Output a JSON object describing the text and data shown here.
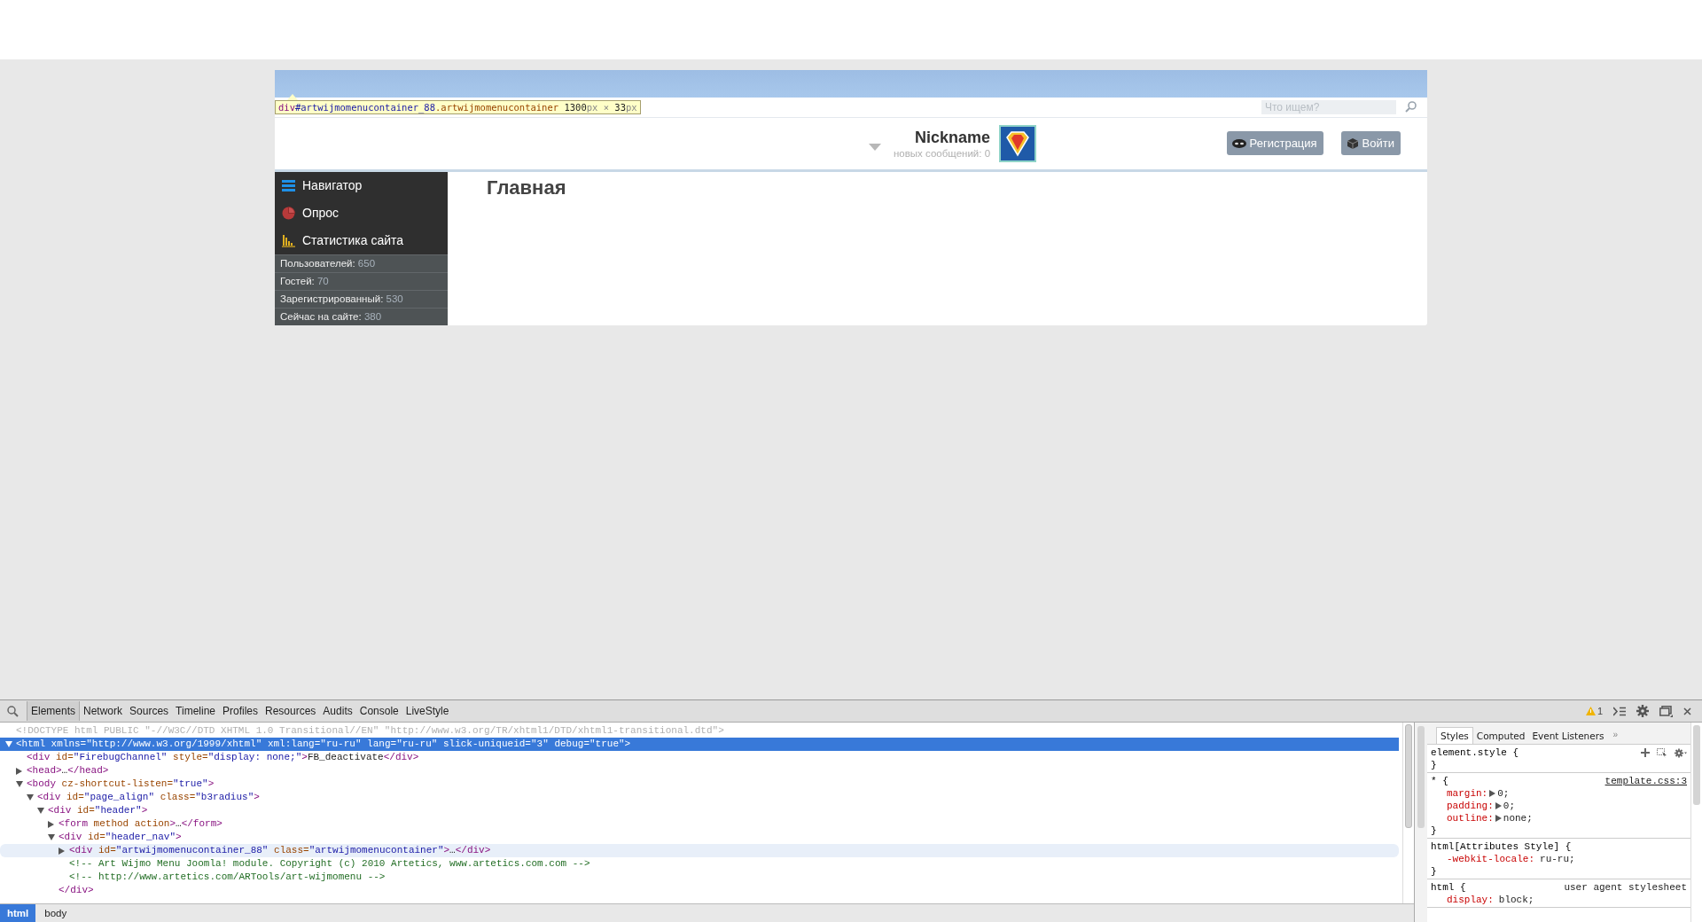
{
  "site": {
    "inspect_tooltip": [
      {
        "kind": "tag",
        "text": "div"
      },
      {
        "kind": "id",
        "text": "#artwijmomenucontainer_88"
      },
      {
        "kind": "class",
        "text": ".artwijmomenucontainer"
      },
      {
        "kind": "num",
        "text": " 1300"
      },
      {
        "kind": "unit",
        "text": "px"
      },
      {
        "kind": "unit",
        "text": " × "
      },
      {
        "kind": "num",
        "text": "33"
      },
      {
        "kind": "unit",
        "text": "px"
      }
    ],
    "search": {
      "placeholder": "Что ищем?"
    },
    "user": {
      "name": "Nickname",
      "messages": "новых сообщений: 0"
    },
    "buttons": [
      {
        "label": "Регистрация"
      },
      {
        "label": "Войти"
      }
    ],
    "sidebar": {
      "menu": [
        {
          "label": "Навигатор"
        },
        {
          "label": "Опрос"
        },
        {
          "label": "Статистика сайта"
        }
      ],
      "stats": [
        {
          "label": "Пользователей:",
          "value": "650"
        },
        {
          "label": "Гостей:",
          "value": "70"
        },
        {
          "label": "Зарегистрированный:",
          "value": "530"
        },
        {
          "label": "Сейчас на сайте:",
          "value": "380"
        }
      ]
    },
    "heading": "Главная"
  },
  "devtools": {
    "tabs": [
      {
        "label": "Elements",
        "selected": true
      },
      {
        "label": "Network",
        "selected": false
      },
      {
        "label": "Sources",
        "selected": false
      },
      {
        "label": "Timeline",
        "selected": false
      },
      {
        "label": "Profiles",
        "selected": false
      },
      {
        "label": "Resources",
        "selected": false
      },
      {
        "label": "Audits",
        "selected": false
      },
      {
        "label": "Console",
        "selected": false
      },
      {
        "label": "LiveStyle",
        "selected": false
      }
    ],
    "warnings": "1",
    "dom": [
      {
        "parts": [
          {
            "kind": "doctype",
            "text": "<!DOCTYPE html PUBLIC \"-//W3C//DTD XHTML 1.0 Transitional//EN\" \"http://www.w3.org/TR/xhtml1/DTD/xhtml1-transitional.dtd\">"
          }
        ],
        "selected": false,
        "hovered": false
      },
      {
        "parts": [
          {
            "kind": "tag",
            "text": "<html"
          },
          {
            "kind": "attr",
            "text": " xmlns="
          },
          {
            "kind": "value",
            "text": "\"http://www.w3.org/1999/xhtml\""
          },
          {
            "kind": "attr",
            "text": " xml:lang="
          },
          {
            "kind": "value",
            "text": "\"ru-ru\""
          },
          {
            "kind": "attr",
            "text": " lang="
          },
          {
            "kind": "value",
            "text": "\"ru-ru\""
          },
          {
            "kind": "attr",
            "text": " slick-uniqueid="
          },
          {
            "kind": "value",
            "text": "\"3\""
          },
          {
            "kind": "attr",
            "text": " debug="
          },
          {
            "kind": "value",
            "text": "\"true\""
          },
          {
            "kind": "tag",
            "text": ">"
          }
        ],
        "expanded": true,
        "selected": true,
        "hovered": false,
        "children": [
          {
            "parts": [
              {
                "kind": "tag",
                "text": "<div"
              },
              {
                "kind": "attr",
                "text": " id="
              },
              {
                "kind": "value",
                "text": "\"FirebugChannel\""
              },
              {
                "kind": "attr",
                "text": " style="
              },
              {
                "kind": "value",
                "text": "\"display: none;\""
              },
              {
                "kind": "tag",
                "text": ">"
              },
              {
                "kind": "text",
                "text": "FB_deactivate"
              },
              {
                "kind": "tag",
                "text": "</div>"
              }
            ],
            "selected": false,
            "hovered": false
          },
          {
            "parts": [
              {
                "kind": "tag",
                "text": "<head>"
              },
              {
                "kind": "text",
                "text": "…"
              },
              {
                "kind": "tag",
                "text": "</head>"
              }
            ],
            "expanded": false,
            "selected": false,
            "hovered": false
          },
          {
            "parts": [
              {
                "kind": "tag",
                "text": "<body"
              },
              {
                "kind": "attr",
                "text": " cz-shortcut-listen="
              },
              {
                "kind": "value",
                "text": "\"true\""
              },
              {
                "kind": "tag",
                "text": ">"
              }
            ],
            "expanded": true,
            "selected": false,
            "hovered": false,
            "children": [
              {
                "parts": [
                  {
                    "kind": "tag",
                    "text": "<div"
                  },
                  {
                    "kind": "attr",
                    "text": " id="
                  },
                  {
                    "kind": "value",
                    "text": "\"page_align\""
                  },
                  {
                    "kind": "attr",
                    "text": " class="
                  },
                  {
                    "kind": "value",
                    "text": "\"b3radius\""
                  },
                  {
                    "kind": "tag",
                    "text": ">"
                  }
                ],
                "expanded": true,
                "selected": false,
                "hovered": false,
                "children": [
                  {
                    "parts": [
                      {
                        "kind": "tag",
                        "text": "<div"
                      },
                      {
                        "kind": "attr",
                        "text": " id="
                      },
                      {
                        "kind": "value",
                        "text": "\"header\""
                      },
                      {
                        "kind": "tag",
                        "text": ">"
                      }
                    ],
                    "expanded": true,
                    "selected": false,
                    "hovered": false,
                    "children": [
                      {
                        "parts": [
                          {
                            "kind": "tag",
                            "text": "<form"
                          },
                          {
                            "kind": "attr",
                            "text": " method action"
                          },
                          {
                            "kind": "tag",
                            "text": ">"
                          },
                          {
                            "kind": "text",
                            "text": "…"
                          },
                          {
                            "kind": "tag",
                            "text": "</form>"
                          }
                        ],
                        "expanded": false,
                        "selected": false,
                        "hovered": false
                      },
                      {
                        "parts": [
                          {
                            "kind": "tag",
                            "text": "<div"
                          },
                          {
                            "kind": "attr",
                            "text": " id="
                          },
                          {
                            "kind": "value",
                            "text": "\"header_nav\""
                          },
                          {
                            "kind": "tag",
                            "text": ">"
                          }
                        ],
                        "expanded": true,
                        "selected": false,
                        "hovered": false,
                        "close": "</div>",
                        "children": [
                          {
                            "parts": [
                              {
                                "kind": "tag",
                                "text": "<div"
                              },
                              {
                                "kind": "attr",
                                "text": " id="
                              },
                              {
                                "kind": "value",
                                "text": "\"artwijmomenucontainer_88\""
                              },
                              {
                                "kind": "attr",
                                "text": " class="
                              },
                              {
                                "kind": "value",
                                "text": "\"artwijmomenucontainer\""
                              },
                              {
                                "kind": "tag",
                                "text": ">"
                              },
                              {
                                "kind": "text",
                                "text": "…"
                              },
                              {
                                "kind": "tag",
                                "text": "</div>"
                              }
                            ],
                            "expanded": false,
                            "selected": false,
                            "hovered": true
                          },
                          {
                            "parts": [
                              {
                                "kind": "comment",
                                "text": "<!-- Art Wijmo Menu Joomla! module. Copyright (c) 2010 Artetics, www.artetics.com.com -->"
                              }
                            ],
                            "selected": false,
                            "hovered": false
                          },
                          {
                            "parts": [
                              {
                                "kind": "comment",
                                "text": "<!-- http://www.artetics.com/ARTools/art-wijmomenu -->"
                              }
                            ],
                            "selected": false,
                            "hovered": false
                          }
                        ]
                      }
                    ]
                  }
                ]
              }
            ]
          }
        ]
      }
    ],
    "breadcrumbs": [
      {
        "label": "html",
        "selected": true
      },
      {
        "label": "body",
        "selected": false
      }
    ],
    "side_tabs": [
      {
        "label": "Styles",
        "selected": true
      },
      {
        "label": "Computed",
        "selected": false
      },
      {
        "label": "Event Listeners",
        "selected": false
      }
    ],
    "side_more": "»",
    "rules": [
      {
        "selector": "element.style {",
        "close": "}",
        "tools": true
      },
      {
        "selector": "* {",
        "source": "template.css:3",
        "link": true,
        "close": "}",
        "props": [
          {
            "name": "margin:",
            "value": "0;",
            "expandable": true
          },
          {
            "name": "padding:",
            "value": "0;",
            "expandable": true
          },
          {
            "name": "outline:",
            "value": "none;",
            "expandable": true
          }
        ]
      },
      {
        "selector": "html[Attributes Style] {",
        "close": "}",
        "props": [
          {
            "name": "-webkit-locale:",
            "value": "ru-ru;",
            "expandable": false
          }
        ]
      },
      {
        "selector": "html {",
        "source": "user agent stylesheet",
        "link": false,
        "props": [
          {
            "name": "display:",
            "value": "block;",
            "expandable": false
          }
        ]
      }
    ]
  }
}
